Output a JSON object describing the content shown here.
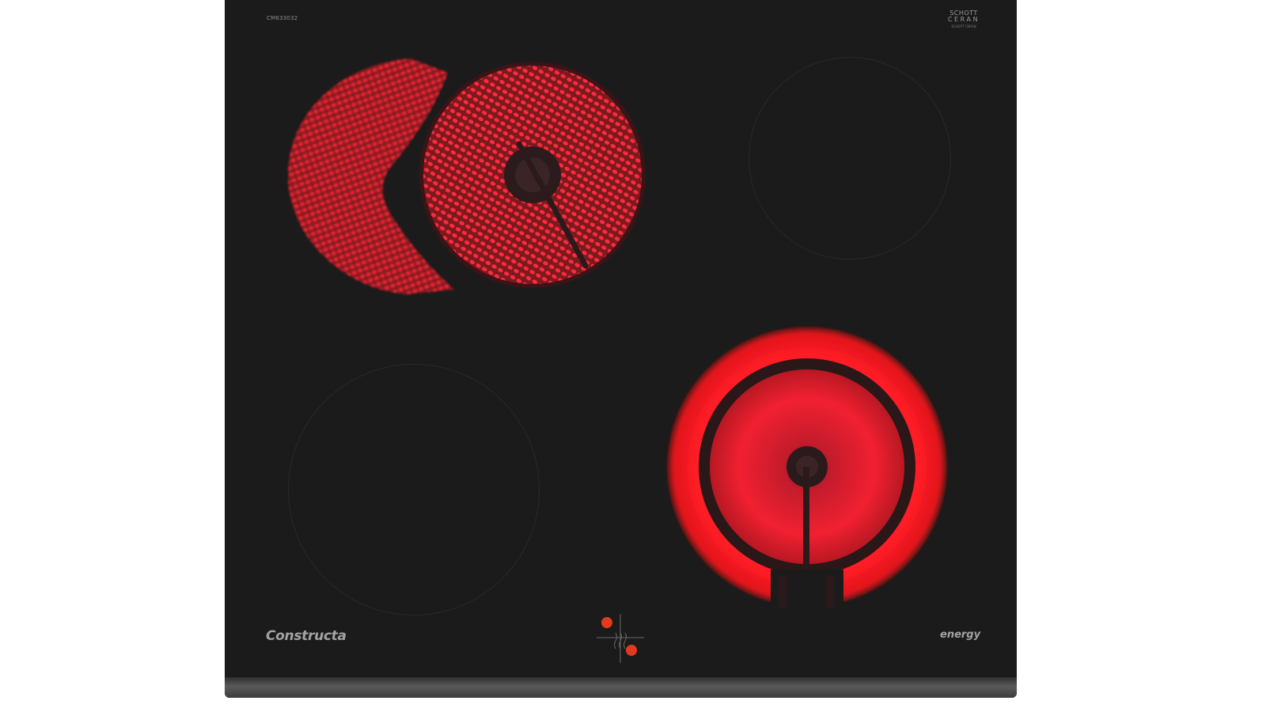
{
  "model_number": "CM633032",
  "glass_logo": {
    "line1": "SCHOTT",
    "line2": "CERAN",
    "line3": "SCHOTT CERAN"
  },
  "brand": "Constructa",
  "energy_label": "energy",
  "colors": {
    "glass": "#1c1b1b",
    "heat_red": "#e8222f",
    "indicator": "#e2391f",
    "print_grey": "#a3a3a3"
  },
  "cooking_zones": [
    {
      "name": "front-left",
      "state": "off"
    },
    {
      "name": "front-right",
      "state": "dual-circuit-on"
    },
    {
      "name": "rear-left",
      "state": "extended-roaster-on"
    },
    {
      "name": "rear-right",
      "state": "off"
    }
  ],
  "control_indicators": [
    {
      "name": "rear-left-zone-light",
      "state": "on"
    },
    {
      "name": "front-right-zone-light",
      "state": "on"
    }
  ]
}
